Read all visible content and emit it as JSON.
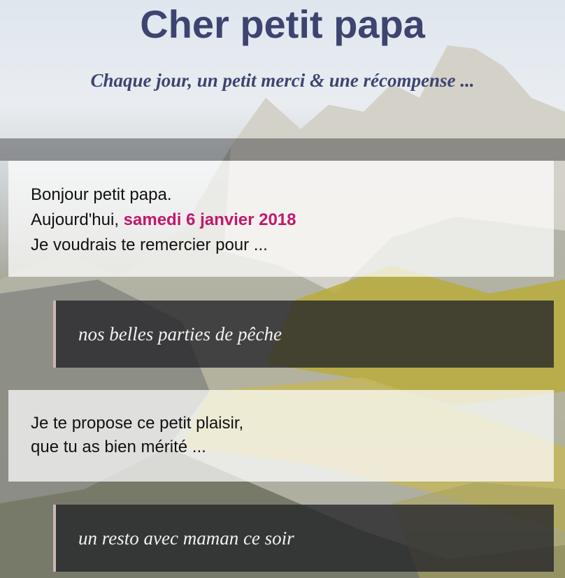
{
  "header": {
    "title": "Cher petit papa",
    "subtitle": "Chaque jour, un petit merci & une récompense ..."
  },
  "greeting": {
    "line1": "Bonjour petit papa.",
    "line2_prefix": "Aujourd'hui, ",
    "date": "samedi 6 janvier 2018",
    "line3": "Je voudrais te remercier pour ..."
  },
  "thanks_item": "nos belles parties de pêche",
  "proposal": {
    "line1": "Je te propose ce petit plaisir,",
    "line2": "que tu as bien mérité ..."
  },
  "reward_item": "un resto avec maman ce soir",
  "colors": {
    "title": "#3e4470",
    "date_accent": "#c0186c"
  }
}
